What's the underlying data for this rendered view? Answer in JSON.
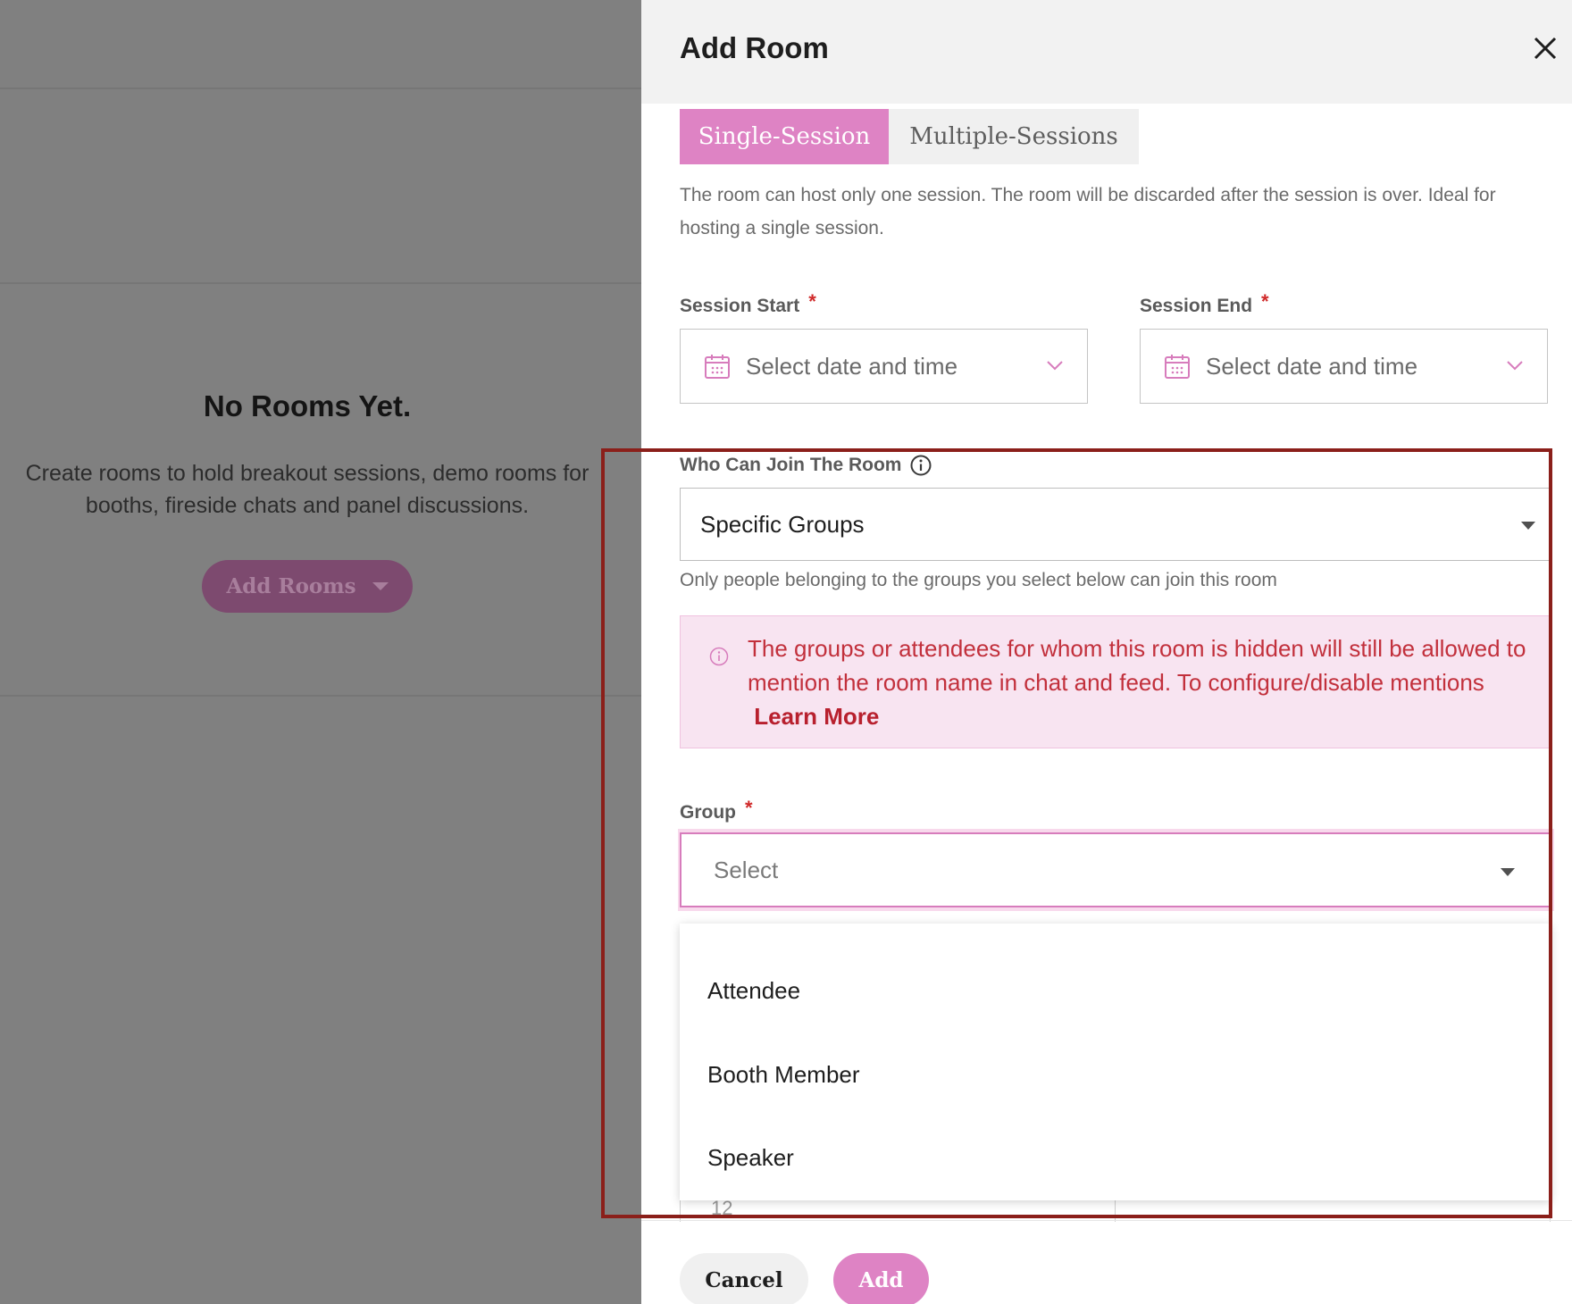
{
  "empty_state": {
    "title": "No Rooms Yet.",
    "description": "Create rooms to hold breakout sessions, demo rooms for booths, fireside chats and panel discussions.",
    "add_rooms_label": "Add Rooms"
  },
  "panel": {
    "title": "Add Room",
    "tabs": [
      {
        "label": "Single-Session",
        "active": true
      },
      {
        "label": "Multiple-Sessions",
        "active": false
      }
    ],
    "tab_description": "The room can host only one session. The room will be discarded after the session is over. Ideal for hosting a single session.",
    "session_start": {
      "label": "Session Start",
      "placeholder": "Select date and time"
    },
    "session_end": {
      "label": "Session End",
      "placeholder": "Select date and time"
    },
    "who_can_join": {
      "label": "Who Can Join The Room",
      "value": "Specific Groups",
      "helper": "Only people belonging to the groups you select below can join this room"
    },
    "notice": {
      "text": "The groups or attendees for whom this room is hidden will still be allowed to mention the room name in chat and feed. To configure/disable mentions",
      "link": "Learn More"
    },
    "group": {
      "label": "Group",
      "placeholder": "Select",
      "options": [
        "Attendee",
        "Booth Member",
        "Speaker"
      ]
    },
    "background_value": "12",
    "cancel_label": "Cancel",
    "add_label": "Add",
    "required_mark": "*"
  },
  "colors": {
    "accent": "#de83c4",
    "notice_bg": "#f8e4f1",
    "notice_text": "#c2303c",
    "highlight": "#8b1f1a"
  }
}
